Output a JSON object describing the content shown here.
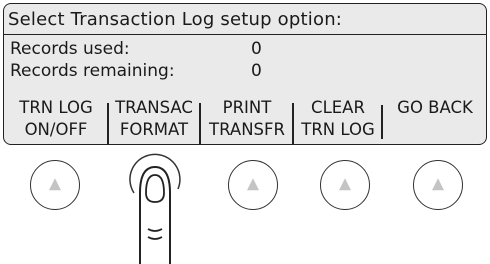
{
  "screen": {
    "title": "Select Transaction Log setup option:",
    "records_used_label": "Records used:",
    "records_used_value": "0",
    "records_remaining_label": "Records remaining:",
    "records_remaining_value": "0"
  },
  "softkeys": [
    {
      "line1": "TRN LOG",
      "line2": "ON/OFF"
    },
    {
      "line1": "TRANSAC",
      "line2": "FORMAT"
    },
    {
      "line1": "PRINT",
      "line2": "TRANSFR"
    },
    {
      "line1": "CLEAR",
      "line2": "TRN LOG"
    },
    {
      "line1": "GO BACK",
      "line2": ""
    }
  ],
  "hardware_buttons": {
    "icon": "up-arrow-icon",
    "pressed_index": 1,
    "pressed_indicator": "finger-press-icon"
  },
  "colors": {
    "screen_bg": "#eaeaea",
    "border": "#222222",
    "button_arrow": "#c4c4c4"
  }
}
